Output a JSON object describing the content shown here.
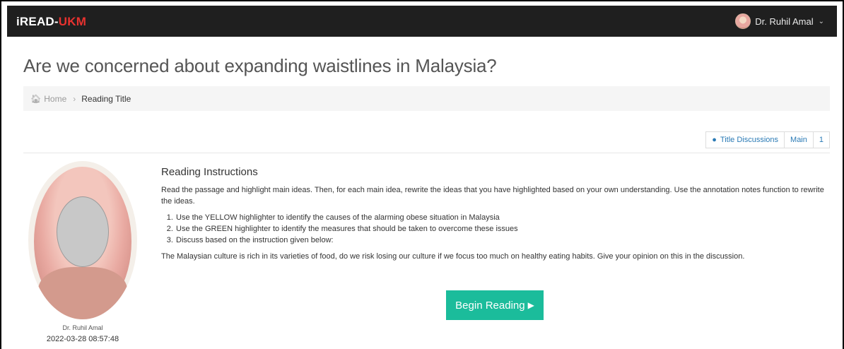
{
  "navbar": {
    "brand_prefix": "iREAD-",
    "brand_suffix": "UKM",
    "user_name": "Dr. Ruhil Amal",
    "chevron_icon": "chevron-down-icon",
    "accent_brand_color": "#e8322f",
    "background_color": "#1f1f1f"
  },
  "page": {
    "title": "Are we concerned about expanding waistlines in Malaysia?"
  },
  "breadcrumb": {
    "home_label": "Home",
    "current_label": "Reading Title"
  },
  "tabs": [
    {
      "label": "Title Discussions",
      "icon": "comments-icon"
    },
    {
      "label": "Main"
    },
    {
      "label": "1"
    }
  ],
  "author": {
    "name": "Dr. Ruhil Amal",
    "timestamp": "2022-03-28 08:57:48"
  },
  "instructions": {
    "heading": "Reading Instructions",
    "intro": "Read the passage and highlight main ideas. Then, for each main idea, rewrite the ideas that you have highlighted based on your own understanding. Use the annotation notes function to rewrite the ideas.",
    "steps": [
      "Use the YELLOW highlighter to identify the causes of the alarming obese situation in Malaysia",
      "Use the GREEN highlighter to identify the measures that should be taken to overcome these issues",
      "Discuss based on the instruction given below:"
    ],
    "discussion": "The Malaysian culture is rich in its varieties of food, do we risk losing our culture if we focus too much on healthy eating habits. Give your opinion on this in the discussion."
  },
  "actions": {
    "begin_label": "Begin Reading",
    "button_color": "#1bbc9b"
  }
}
